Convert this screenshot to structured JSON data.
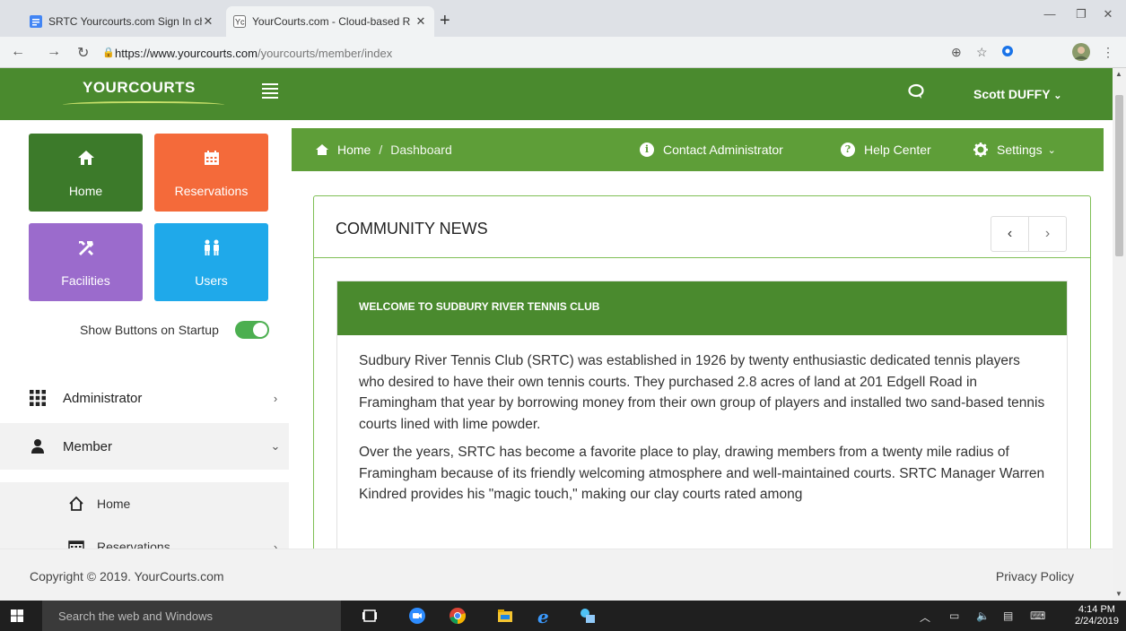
{
  "browser": {
    "tabs": [
      {
        "title": "SRTC Yourcourts.com Sign In che",
        "active": false
      },
      {
        "title": "YourCourts.com - Cloud-based R",
        "active": true
      }
    ],
    "url_host": "https://www.yourcourts.com",
    "url_path": "/yourcourts/member/index"
  },
  "header": {
    "logo_text": "YOURCOURTS",
    "user_name": "Scott DUFFY"
  },
  "sidebar": {
    "tiles": [
      {
        "label": "Home",
        "icon": "home-icon",
        "color": "#3c7a2a"
      },
      {
        "label": "Reservations",
        "icon": "calendar-icon",
        "color": "#f46a3a"
      },
      {
        "label": "Facilities",
        "icon": "tools-icon",
        "color": "#9b6bcc"
      },
      {
        "label": "Users",
        "icon": "users-icon",
        "color": "#1fa9ea"
      }
    ],
    "startup_label": "Show Buttons on Startup",
    "startup_enabled": true,
    "menu": [
      {
        "label": "Administrator",
        "icon": "grid-icon"
      },
      {
        "label": "Member",
        "icon": "user-icon"
      }
    ],
    "submenu": [
      {
        "label": "Home",
        "icon": "home-outline-icon"
      },
      {
        "label": "Reservations",
        "icon": "calendar-icon"
      }
    ]
  },
  "breadcrumb": {
    "home": "Home",
    "separator": "/",
    "current": "Dashboard"
  },
  "toolbar": {
    "contact": "Contact Administrator",
    "help": "Help Center",
    "settings": "Settings"
  },
  "news": {
    "title": "COMMUNITY NEWS",
    "article_title": "WELCOME TO SUDBURY RIVER TENNIS CLUB",
    "paragraphs": [
      "Sudbury River Tennis Club (SRTC) was established in 1926 by twenty enthusiastic dedicated tennis players who desired to have their own tennis courts. They purchased 2.8 acres of land at 201 Edgell Road in Framingham that year by borrowing money from their own group of players and installed two sand-based tennis courts lined with lime powder.",
      "Over the years, SRTC has become a favorite place to play, drawing members from a twenty mile radius of Framingham because of its friendly welcoming atmosphere and well-maintained courts. SRTC Manager Warren Kindred provides his \"magic touch,\" making our clay courts rated among"
    ]
  },
  "footer": {
    "copyright": "Copyright © 2019. YourCourts.com",
    "privacy": "Privacy Policy"
  },
  "taskbar": {
    "search_placeholder": "Search the web and Windows",
    "time": "4:14 PM",
    "date": "2/24/2019"
  },
  "colors": {
    "header_green": "#4a8a2e",
    "crumb_green": "#5e9e38",
    "border_green": "#7fbf55"
  }
}
